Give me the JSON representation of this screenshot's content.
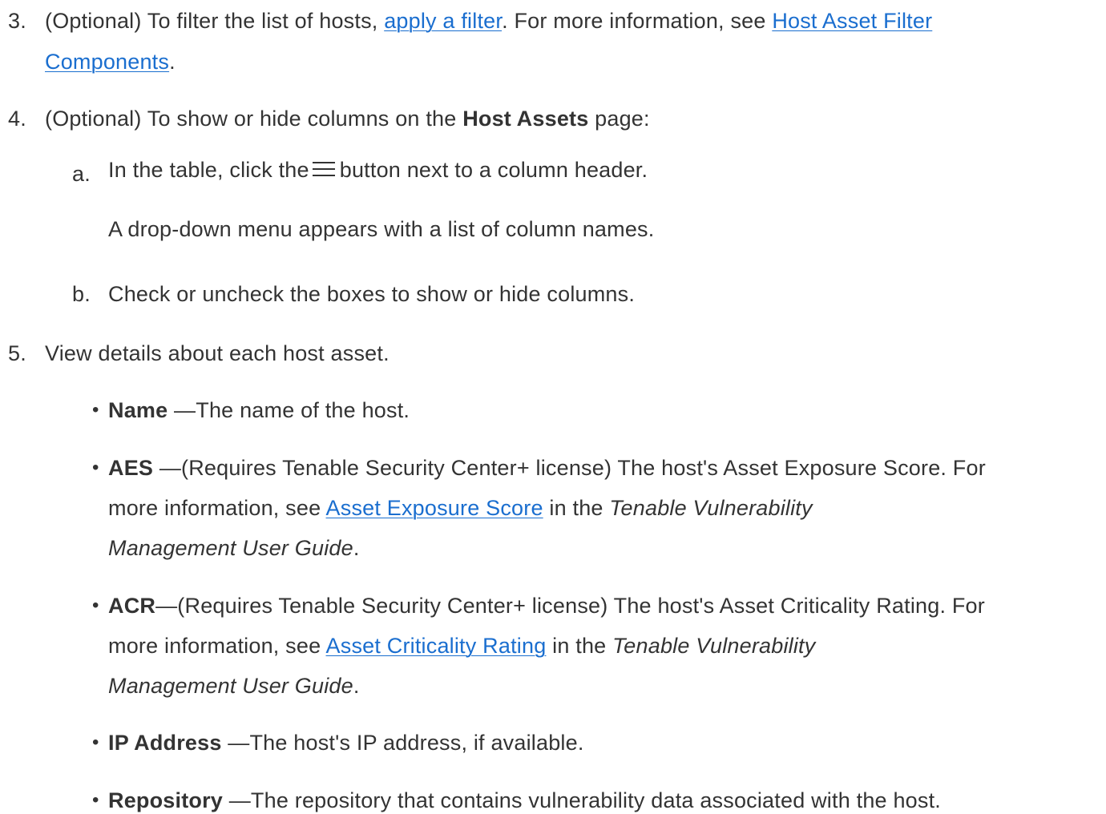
{
  "steps": {
    "s3": {
      "number": "3.",
      "text_a": "(Optional) To filter the list of hosts, ",
      "link_apply": "apply a filter",
      "text_b": ". For more information, see ",
      "link_filter_line1": "Host Asset Filter",
      "link_filter_line2": "Components",
      "text_end": "."
    },
    "s4": {
      "number": "4.",
      "text_a": "(Optional) To show or hide columns on the ",
      "bold": "Host Assets",
      "text_b": " page:",
      "sub_a": {
        "letter": "a.",
        "text_a": "In the table, click the",
        "icon": "hamburger-menu-icon",
        "text_b": "button next to a column header.",
        "result": "A drop-down menu appears with a list of column names."
      },
      "sub_b": {
        "letter": "b.",
        "text": "Check or uncheck the boxes to show or hide columns."
      }
    },
    "s5": {
      "number": "5.",
      "text": "View details about each host asset.",
      "items": [
        {
          "bullet": "•",
          "label": "Name",
          "text": " —The name of the host."
        },
        {
          "bullet": "•",
          "label": "AES",
          "text_a": " —(Requires Tenable Security Center+ license) The host's Asset Exposure Score. For",
          "text_b": "more information, see ",
          "link": "Asset Exposure Score",
          "text_c": " in the ",
          "italic_a": "Tenable Vulnerability",
          "italic_b": "Management User Guide",
          "text_end": "."
        },
        {
          "bullet": "•",
          "label": "ACR",
          "text_a": "—(Requires Tenable Security Center+ license) The host's Asset Criticality Rating. For",
          "text_b": "more information, see ",
          "link": "Asset Criticality Rating",
          "text_c": " in the ",
          "italic_a": "Tenable Vulnerability",
          "italic_b": "Management User Guide",
          "text_end": "."
        },
        {
          "bullet": "•",
          "label": "IP Address",
          "text": " —The host's IP address, if available."
        },
        {
          "bullet": "•",
          "label": "Repository",
          "text": " —The repository that contains vulnerability data associated with the host."
        }
      ]
    }
  },
  "colors": {
    "text": "#333333",
    "link": "#1a6ecf",
    "background": "#ffffff"
  }
}
